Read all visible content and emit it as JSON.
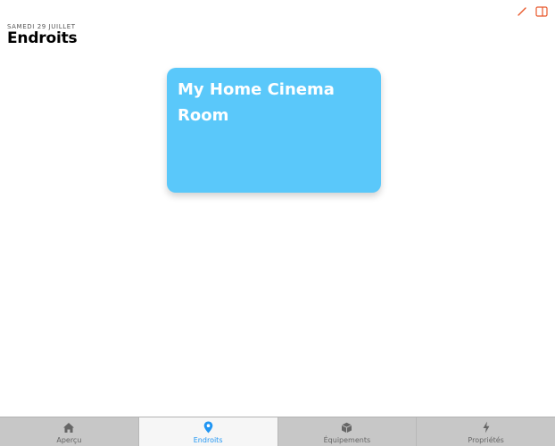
{
  "header": {
    "date": "SAMEDI 29 JUILLET",
    "title": "Endroits"
  },
  "actions": [
    {
      "icon": "edit-icon",
      "color": "#e8572a"
    },
    {
      "icon": "sidebar-icon",
      "color": "#e8572a"
    }
  ],
  "places": [
    {
      "name": "My Home Cinema Room",
      "color": "#5ac8fa"
    }
  ],
  "tabbar": {
    "tabs": [
      {
        "label": "Aperçu",
        "icon": "home-icon",
        "active": false
      },
      {
        "label": "Endroits",
        "icon": "location-pin-icon",
        "active": true
      },
      {
        "label": "Équipements",
        "icon": "box-icon",
        "active": false
      },
      {
        "label": "Propriétés",
        "icon": "lightning-icon",
        "active": false
      }
    ],
    "active_color": "#2196f3",
    "inactive_color": "#666666"
  }
}
